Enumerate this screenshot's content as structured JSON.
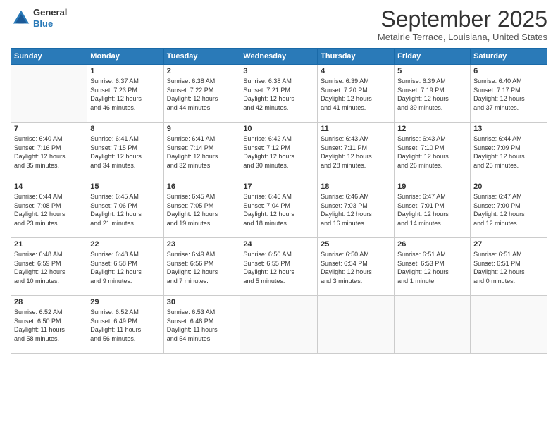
{
  "header": {
    "logo": {
      "line1": "General",
      "line2": "Blue"
    },
    "title": "September 2025",
    "location": "Metairie Terrace, Louisiana, United States"
  },
  "calendar": {
    "days_of_week": [
      "Sunday",
      "Monday",
      "Tuesday",
      "Wednesday",
      "Thursday",
      "Friday",
      "Saturday"
    ],
    "weeks": [
      [
        {
          "day": "",
          "info": ""
        },
        {
          "day": "1",
          "info": "Sunrise: 6:37 AM\nSunset: 7:23 PM\nDaylight: 12 hours\nand 46 minutes."
        },
        {
          "day": "2",
          "info": "Sunrise: 6:38 AM\nSunset: 7:22 PM\nDaylight: 12 hours\nand 44 minutes."
        },
        {
          "day": "3",
          "info": "Sunrise: 6:38 AM\nSunset: 7:21 PM\nDaylight: 12 hours\nand 42 minutes."
        },
        {
          "day": "4",
          "info": "Sunrise: 6:39 AM\nSunset: 7:20 PM\nDaylight: 12 hours\nand 41 minutes."
        },
        {
          "day": "5",
          "info": "Sunrise: 6:39 AM\nSunset: 7:19 PM\nDaylight: 12 hours\nand 39 minutes."
        },
        {
          "day": "6",
          "info": "Sunrise: 6:40 AM\nSunset: 7:17 PM\nDaylight: 12 hours\nand 37 minutes."
        }
      ],
      [
        {
          "day": "7",
          "info": "Sunrise: 6:40 AM\nSunset: 7:16 PM\nDaylight: 12 hours\nand 35 minutes."
        },
        {
          "day": "8",
          "info": "Sunrise: 6:41 AM\nSunset: 7:15 PM\nDaylight: 12 hours\nand 34 minutes."
        },
        {
          "day": "9",
          "info": "Sunrise: 6:41 AM\nSunset: 7:14 PM\nDaylight: 12 hours\nand 32 minutes."
        },
        {
          "day": "10",
          "info": "Sunrise: 6:42 AM\nSunset: 7:12 PM\nDaylight: 12 hours\nand 30 minutes."
        },
        {
          "day": "11",
          "info": "Sunrise: 6:43 AM\nSunset: 7:11 PM\nDaylight: 12 hours\nand 28 minutes."
        },
        {
          "day": "12",
          "info": "Sunrise: 6:43 AM\nSunset: 7:10 PM\nDaylight: 12 hours\nand 26 minutes."
        },
        {
          "day": "13",
          "info": "Sunrise: 6:44 AM\nSunset: 7:09 PM\nDaylight: 12 hours\nand 25 minutes."
        }
      ],
      [
        {
          "day": "14",
          "info": "Sunrise: 6:44 AM\nSunset: 7:08 PM\nDaylight: 12 hours\nand 23 minutes."
        },
        {
          "day": "15",
          "info": "Sunrise: 6:45 AM\nSunset: 7:06 PM\nDaylight: 12 hours\nand 21 minutes."
        },
        {
          "day": "16",
          "info": "Sunrise: 6:45 AM\nSunset: 7:05 PM\nDaylight: 12 hours\nand 19 minutes."
        },
        {
          "day": "17",
          "info": "Sunrise: 6:46 AM\nSunset: 7:04 PM\nDaylight: 12 hours\nand 18 minutes."
        },
        {
          "day": "18",
          "info": "Sunrise: 6:46 AM\nSunset: 7:03 PM\nDaylight: 12 hours\nand 16 minutes."
        },
        {
          "day": "19",
          "info": "Sunrise: 6:47 AM\nSunset: 7:01 PM\nDaylight: 12 hours\nand 14 minutes."
        },
        {
          "day": "20",
          "info": "Sunrise: 6:47 AM\nSunset: 7:00 PM\nDaylight: 12 hours\nand 12 minutes."
        }
      ],
      [
        {
          "day": "21",
          "info": "Sunrise: 6:48 AM\nSunset: 6:59 PM\nDaylight: 12 hours\nand 10 minutes."
        },
        {
          "day": "22",
          "info": "Sunrise: 6:48 AM\nSunset: 6:58 PM\nDaylight: 12 hours\nand 9 minutes."
        },
        {
          "day": "23",
          "info": "Sunrise: 6:49 AM\nSunset: 6:56 PM\nDaylight: 12 hours\nand 7 minutes."
        },
        {
          "day": "24",
          "info": "Sunrise: 6:50 AM\nSunset: 6:55 PM\nDaylight: 12 hours\nand 5 minutes."
        },
        {
          "day": "25",
          "info": "Sunrise: 6:50 AM\nSunset: 6:54 PM\nDaylight: 12 hours\nand 3 minutes."
        },
        {
          "day": "26",
          "info": "Sunrise: 6:51 AM\nSunset: 6:53 PM\nDaylight: 12 hours\nand 1 minute."
        },
        {
          "day": "27",
          "info": "Sunrise: 6:51 AM\nSunset: 6:51 PM\nDaylight: 12 hours\nand 0 minutes."
        }
      ],
      [
        {
          "day": "28",
          "info": "Sunrise: 6:52 AM\nSunset: 6:50 PM\nDaylight: 11 hours\nand 58 minutes."
        },
        {
          "day": "29",
          "info": "Sunrise: 6:52 AM\nSunset: 6:49 PM\nDaylight: 11 hours\nand 56 minutes."
        },
        {
          "day": "30",
          "info": "Sunrise: 6:53 AM\nSunset: 6:48 PM\nDaylight: 11 hours\nand 54 minutes."
        },
        {
          "day": "",
          "info": ""
        },
        {
          "day": "",
          "info": ""
        },
        {
          "day": "",
          "info": ""
        },
        {
          "day": "",
          "info": ""
        }
      ]
    ]
  }
}
